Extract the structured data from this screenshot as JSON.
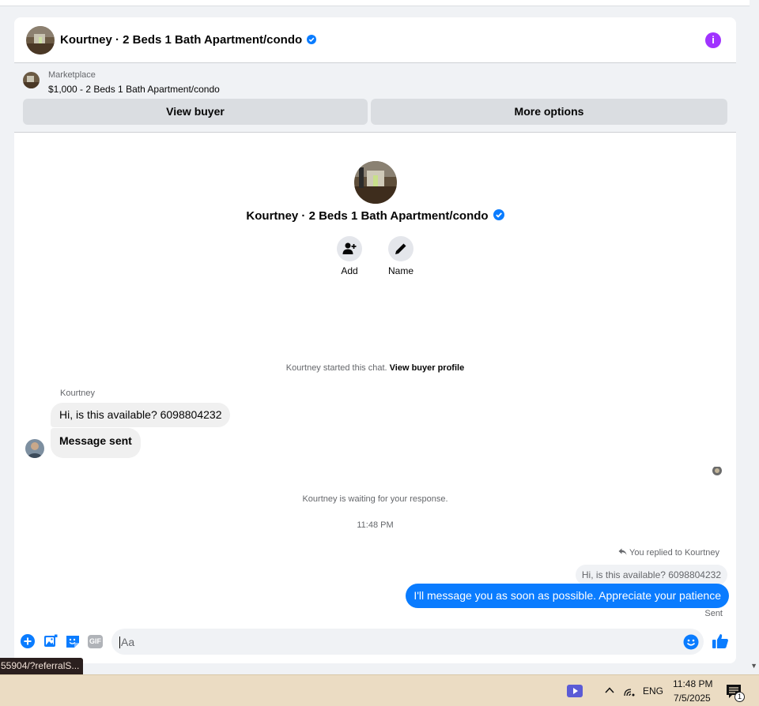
{
  "conversation": {
    "title": "Kourtney · 2 Beds 1 Bath Apartment/condo",
    "verified": true
  },
  "listing": {
    "source": "Marketplace",
    "title": "$1,000 - 2 Beds 1 Bath Apartment/condo",
    "view_buyer_label": "View buyer",
    "more_options_label": "More options"
  },
  "profile": {
    "name": "Kourtney · 2 Beds 1 Bath Apartment/condo",
    "actions": [
      {
        "label": "Add",
        "icon": "add-person-icon"
      },
      {
        "label": "Name",
        "icon": "pencil-icon"
      }
    ]
  },
  "thread": {
    "started_note": "Kourtney started this chat.",
    "view_profile_link": "View buyer profile",
    "sender_name": "Kourtney",
    "incoming": [
      "Hi, is this available? 6098804232",
      "Message sent"
    ],
    "waiting_note": "Kourtney is waiting for your response.",
    "timestamp": "11:48 PM",
    "replied_note": "You replied to Kourtney",
    "quoted_message": "Hi, is this available? 6098804232",
    "outgoing": "I'll message you as soon as possible. Appreciate your patience",
    "delivery_status": "Sent"
  },
  "composer": {
    "placeholder": "Aa",
    "icons": [
      "plus-icon",
      "photo-icon",
      "sticker-icon",
      "gif-icon",
      "emoji-icon",
      "thumbs-up-icon"
    ],
    "gif_label": "GIF"
  },
  "status_bar": {
    "url_text": "55904/?referralS..."
  },
  "taskbar": {
    "language": "ENG",
    "time": "11:48 PM",
    "date": "7/5/2025",
    "notification_count": "1"
  },
  "colors": {
    "accent": "#0a7cff",
    "info": "#a033ff",
    "bubble_in": "#f0f0f0",
    "taskbar": "#ebdcc3"
  }
}
